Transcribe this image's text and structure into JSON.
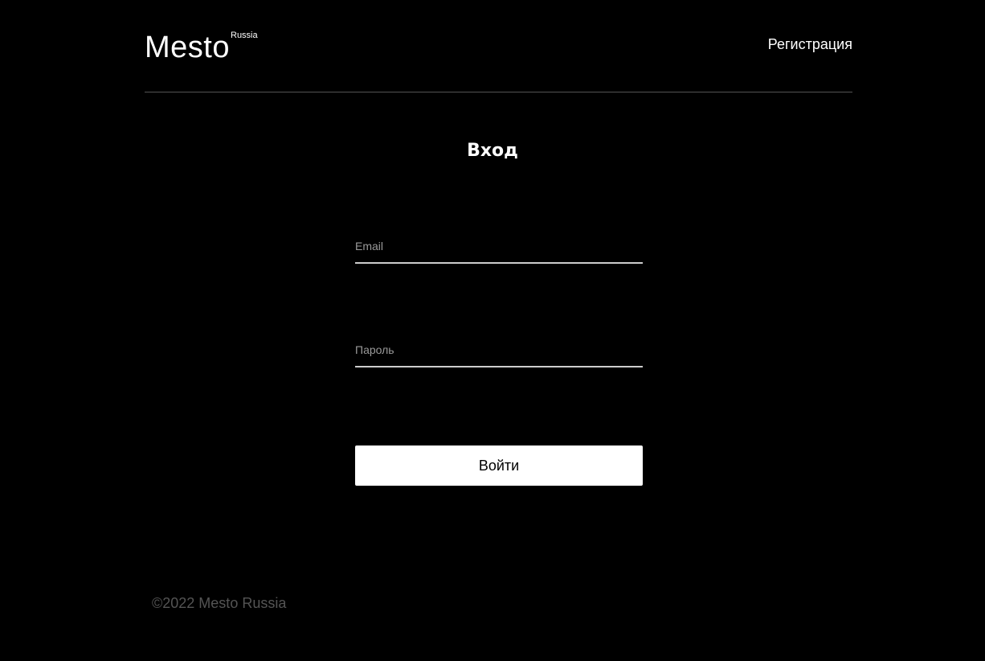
{
  "header": {
    "logo_main": "Mesto",
    "logo_sub": "Russia",
    "nav_link": "Регистрация"
  },
  "main": {
    "title": "Вход",
    "email_placeholder": "Email",
    "password_placeholder": "Пароль",
    "submit_label": "Войти"
  },
  "footer": {
    "copyright": "©2022 Mesto Russia"
  },
  "colors": {
    "background": "#000000",
    "text": "#ffffff",
    "muted": "#545454",
    "input_line": "#cccccc",
    "button_bg": "#ffffff",
    "button_text": "#000000"
  }
}
